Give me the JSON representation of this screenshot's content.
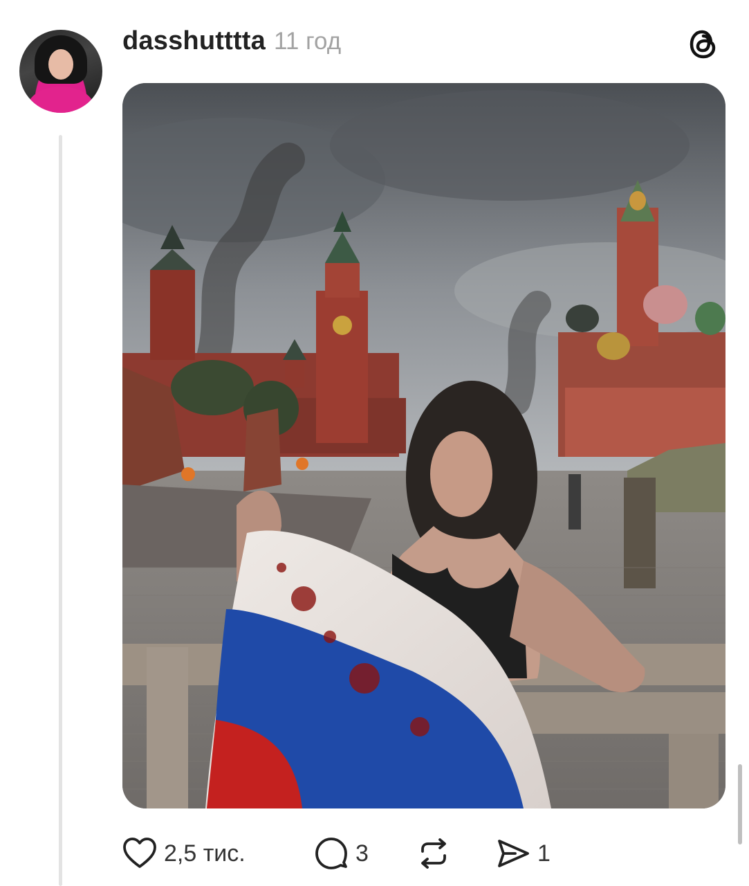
{
  "post": {
    "username": "dasshutttta",
    "time": "11 год"
  },
  "actions": {
    "likes": "2,5 тис.",
    "replies": "3",
    "shares": "1"
  },
  "icons": {
    "logo": "threads-logo-icon",
    "like": "heart-icon",
    "reply": "comment-icon",
    "repost": "repost-icon",
    "share": "send-icon"
  }
}
